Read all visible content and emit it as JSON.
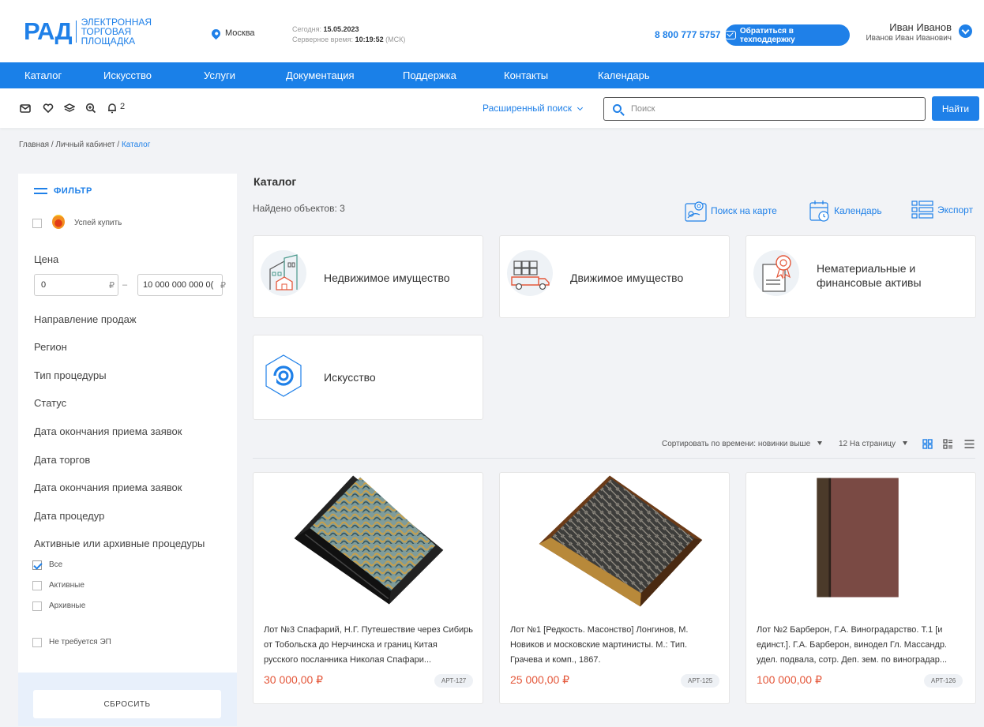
{
  "logo": {
    "mark": "РАД",
    "line1": "ЭЛЕКТРОННАЯ",
    "line2": "ТОРГОВАЯ ПЛОЩАДКА"
  },
  "header": {
    "city": "Москва",
    "today_label": "Сегодня:",
    "today": "15.05.2023",
    "server_label": "Серверное время:",
    "server_time": "10:19:52",
    "tz": "(МСК)",
    "phone": "8 800 777 5757",
    "support": "Обратиться в техподдержку",
    "user_name": "Иван Иванов",
    "user_full": "Иванов Иван Иванович"
  },
  "nav": [
    "Каталог",
    "Искусство",
    "Услуги",
    "Документация",
    "Поддержка",
    "Контакты",
    "Календарь"
  ],
  "toolbar": {
    "notifications": "2",
    "advanced": "Расширенный поиск",
    "search_placeholder": "Поиск",
    "find": "Найти"
  },
  "breadcrumb": {
    "home": "Главная",
    "cabinet": "Личный кабинет",
    "current": "Каталог",
    "sep": "/"
  },
  "filter": {
    "title": "ФИЛЬТР",
    "hurry": "Успей купить",
    "price_label": "Цена",
    "price_from": "0",
    "price_to": "10 000 000 000 0(",
    "currency": "₽",
    "dash": "–",
    "sections": [
      "Направление продаж",
      "Регион",
      "Тип процедуры",
      "Статус",
      "Дата окончания приема заявок",
      "Дата торгов",
      "Дата окончания приема заявок",
      "Дата процедур",
      "Активные или архивные процедуры"
    ],
    "options": [
      {
        "label": "Все",
        "checked": true
      },
      {
        "label": "Активные",
        "checked": false
      },
      {
        "label": "Архивные",
        "checked": false
      }
    ],
    "no_ep": "Не требуется ЭП",
    "reset": "СБРОСИТЬ"
  },
  "catalog": {
    "title": "Каталог",
    "found": "Найдено объектов: 3",
    "tools": {
      "map": "Поиск на карте",
      "calendar": "Календарь",
      "export": "Экспорт"
    },
    "categories": [
      "Недвижимое имущество",
      "Движимое имущество",
      "Нематериальные и финансовые активы",
      "Искусство"
    ],
    "sort": "Сортировать по времени: новинки выше",
    "per_page": "12 На страницу"
  },
  "lots": [
    {
      "title": "Лот №3 Спафарий, Н.Г. Путешествие через Сибирь от Тобольска до Нерчинска и границ Китая русского посланника Николая Спафари...",
      "price": "30 000,00 ₽",
      "code": "АРТ-127"
    },
    {
      "title": "Лот №1 [Редкость. Масонство] Лонгинов, М. Новиков и московские мартинисты. М.: Тип. Грачева и комп., 1867.",
      "price": "25 000,00 ₽",
      "code": "АРТ-125"
    },
    {
      "title": "Лот №2 Барберон, Г.А. Виноградарство. Т.1 [и единст.]. Г.А. Барберон, винодел Гл. Массандр. удел. подвала, сотр. Деп. зем. по виноградар...",
      "price": "100 000,00 ₽",
      "code": "АРТ-126"
    }
  ],
  "colors": {
    "accent": "#1f80e8",
    "price": "#e4573a",
    "nav": "#1a80e8"
  }
}
